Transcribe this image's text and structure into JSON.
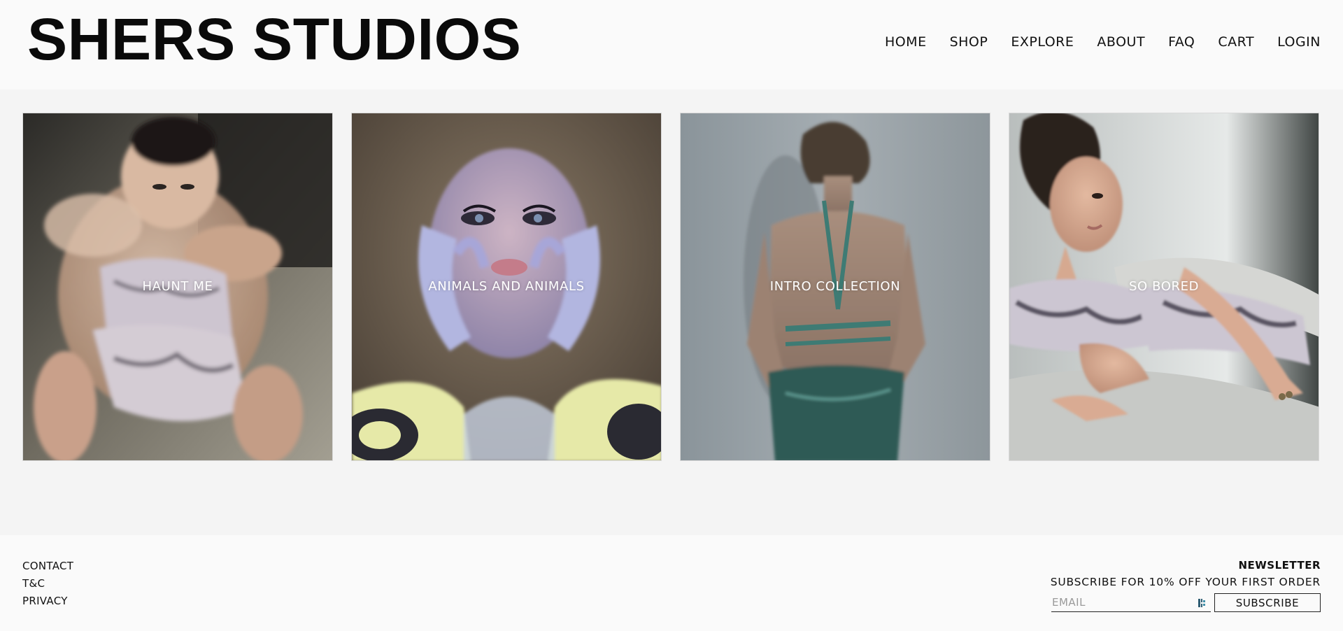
{
  "brand": {
    "name": "SHERS STUDIOS"
  },
  "nav": {
    "items": [
      {
        "label": "HOME"
      },
      {
        "label": "SHOP"
      },
      {
        "label": "EXPLORE"
      },
      {
        "label": "ABOUT"
      },
      {
        "label": "FAQ"
      },
      {
        "label": "CART"
      },
      {
        "label": "LOGIN"
      }
    ]
  },
  "collections": [
    {
      "title": "HAUNT ME"
    },
    {
      "title": "ANIMALS AND ANIMALS"
    },
    {
      "title": "INTRO COLLECTION"
    },
    {
      "title": "SO BORED"
    }
  ],
  "footer": {
    "links": [
      {
        "label": "CONTACT"
      },
      {
        "label": "T&C"
      },
      {
        "label": "PRIVACY"
      }
    ],
    "newsletter": {
      "heading": "NEWSLETTER",
      "tagline": "SUBSCRIBE FOR 10% OFF YOUR FIRST ORDER",
      "email_placeholder": "EMAIL",
      "subscribe_label": "SUBSCRIBE"
    }
  },
  "colors": {
    "header_bg": "#fafafa",
    "page_bg": "#f4f4f4",
    "text": "#111111",
    "overlay_text": "#ffffff"
  }
}
